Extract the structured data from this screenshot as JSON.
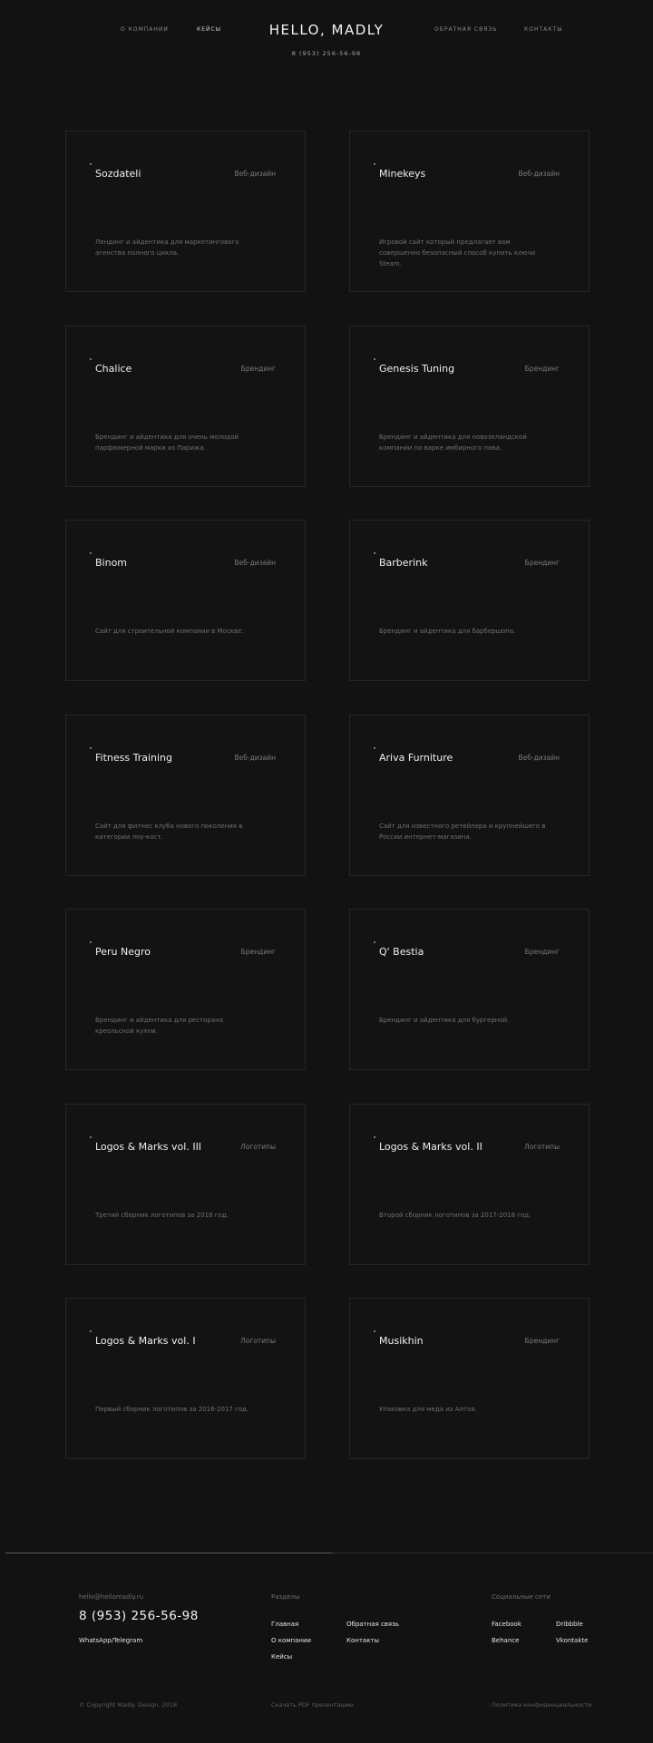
{
  "header": {
    "nav_left": [
      {
        "label": "О КОМПАНИИ"
      },
      {
        "label": "КЕЙСЫ"
      }
    ],
    "logo": "HELLO, MADLY",
    "phone": "8 (953) 256-56-98",
    "nav_right": [
      {
        "label": "ОБРАТНАЯ СВЯЗЬ"
      },
      {
        "label": "КОНТАКТЫ"
      }
    ]
  },
  "cases": [
    {
      "title": "Sozdateli",
      "category": "Веб-дизайн",
      "description": "Лендинг и айдентика для маркетингового агенства полного цикла."
    },
    {
      "title": "Minekeys",
      "category": "Веб-дизайн",
      "description": "Игровой сайт который предлагает вам совершенно безопасный способ купить ключи Steam."
    },
    {
      "title": "Chalice",
      "category": "Брендинг",
      "description": "Брендинг и айдентика для очень молодой парфюмерной марки из Парижа."
    },
    {
      "title": "Genesis Tuning",
      "category": "Брендинг",
      "description": "Брендинг и айдентика для новозеландской компании по варке имбирного пива."
    },
    {
      "title": "Binom",
      "category": "Веб-дизайн",
      "description": "Сайт для строительной компании в Москве."
    },
    {
      "title": "Barberink",
      "category": "Брендинг",
      "description": "Брендинг и айдентика для барбершопа."
    },
    {
      "title": "Fitness Training",
      "category": "Веб-дизайн",
      "description": "Сайт для фитнес клуба нового поколения в категории лоу-кост."
    },
    {
      "title": "Ariva Furniture",
      "category": "Веб-дизайн",
      "description": "Сайт для известного ретейлера и крупнейшего в России интернет-магазина."
    },
    {
      "title": "Peru Negro",
      "category": "Брендинг",
      "description": "Брендинг и айдентика для ресторана креольской кухни."
    },
    {
      "title": "Q' Bestia",
      "category": "Брендинг",
      "description": "Брендинг и айдентика для бургерной."
    },
    {
      "title": "Logos & Marks vol. III",
      "category": "Логотипы",
      "description": "Третий сборник логотипов за 2018 год."
    },
    {
      "title": "Logos & Marks vol. II",
      "category": "Логотипы",
      "description": "Второй сборник логотипов за 2017-2018 год."
    },
    {
      "title": "Logos & Marks vol. I",
      "category": "Логотипы",
      "description": "Первый сборник логотипов за 2016-2017 год."
    },
    {
      "title": "Musikhin",
      "category": "Брендинг",
      "description": "Упаковка для меда из Алтая."
    }
  ],
  "footer": {
    "email": "hello@hellomadly.ru",
    "phone": "8 (953) 256-56-98",
    "messengers": "WhatsApp/Telegram",
    "sections_label": "Разделы",
    "sections": [
      "Главная",
      "О компании",
      "Кейсы",
      "Обратная связь",
      "Контакты"
    ],
    "social_label": "Социальные сети",
    "social": [
      "Facebook",
      "Behance",
      "Dribbble",
      "Vkontakte"
    ],
    "copyright": "© Copyright Madly. Design. 2018",
    "pdf_link": "Скачать PDF презентацию",
    "privacy_link": "Политика конфиденциальности"
  },
  "colors": {
    "background": "#121212",
    "card_border": "#262626",
    "text_primary": "#f0f0f0",
    "text_muted": "#6f6f6f"
  }
}
